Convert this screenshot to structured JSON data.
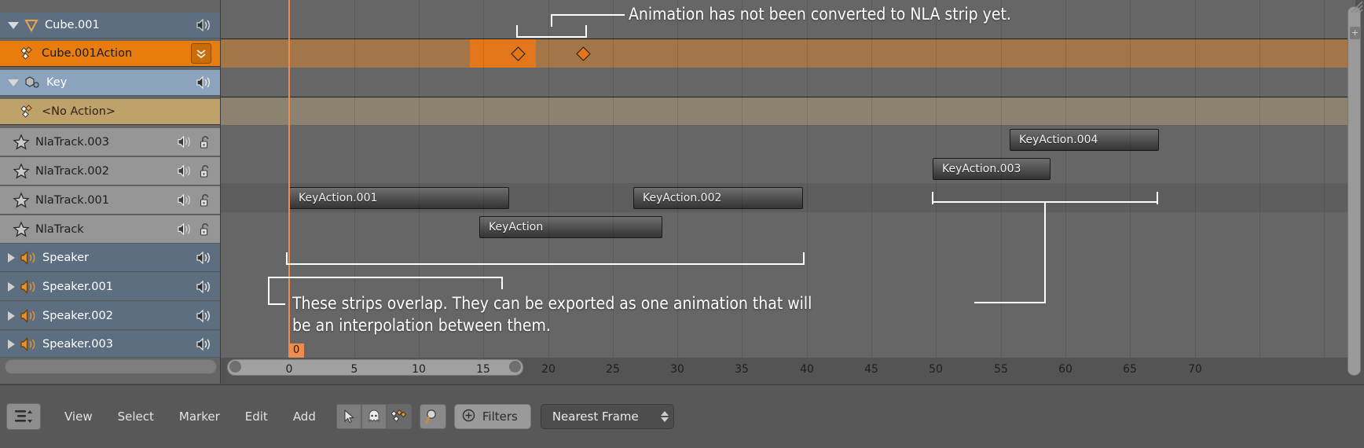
{
  "channels": [
    {
      "name": "Cube.001",
      "type": "object",
      "icon": "mesh-triangle-icon",
      "expander": "down",
      "mute": "speaker-icon",
      "indent": 0
    },
    {
      "name": "Cube.001Action",
      "type": "action",
      "icon": "action-keys-icon",
      "expander": "none",
      "right": "expand-double-icon",
      "indent": 1
    },
    {
      "name": "Key",
      "type": "key",
      "icon": "shapekey-icon",
      "expander": "down",
      "mute": "speaker-icon",
      "indent": 0
    },
    {
      "name": "<No Action>",
      "type": "noaction",
      "icon": "action-keys-icon",
      "expander": "none",
      "indent": 1
    },
    {
      "name": "NlaTrack.003",
      "type": "nlatrack",
      "icon": "star-icon",
      "mute": "speaker-icon",
      "lock": "unlock-icon",
      "indent": 1
    },
    {
      "name": "NlaTrack.002",
      "type": "nlatrack",
      "icon": "star-icon",
      "mute": "speaker-icon",
      "lock": "unlock-icon",
      "indent": 1
    },
    {
      "name": "NlaTrack.001",
      "type": "nlatrack",
      "icon": "star-icon",
      "mute": "speaker-icon",
      "lock": "unlock-icon",
      "indent": 1
    },
    {
      "name": "NlaTrack",
      "type": "nlatrack",
      "icon": "star-icon",
      "mute": "speaker-icon",
      "lock": "unlock-icon",
      "indent": 1
    },
    {
      "name": "Speaker",
      "type": "speaker",
      "icon": "speaker-icon",
      "expander": "right",
      "mute": "speaker-icon",
      "indent": 0
    },
    {
      "name": "Speaker.001",
      "type": "speaker",
      "icon": "speaker-icon",
      "expander": "right",
      "mute": "speaker-icon",
      "indent": 0
    },
    {
      "name": "Speaker.002",
      "type": "speaker",
      "icon": "speaker-icon",
      "expander": "right",
      "mute": "speaker-icon",
      "indent": 0
    },
    {
      "name": "Speaker.003",
      "type": "speaker",
      "icon": "speaker-icon",
      "expander": "right",
      "mute": "speaker-icon",
      "indent": 0
    }
  ],
  "strips": [
    {
      "label": "KeyAction.004",
      "track": "NlaTrack.003"
    },
    {
      "label": "KeyAction.003",
      "track": "NlaTrack.002"
    },
    {
      "label": "KeyAction.001",
      "track": "NlaTrack.001"
    },
    {
      "label": "KeyAction.002",
      "track": "NlaTrack.001"
    },
    {
      "label": "KeyAction",
      "track": "NlaTrack"
    }
  ],
  "annotations": {
    "top": "Animation has not been converted to NLA strip yet.",
    "bottom_line1": "These strips overlap. They can be exported as one animation that will",
    "bottom_line2": "be an interpolation between them."
  },
  "playhead": {
    "value": "0"
  },
  "ruler": {
    "ticks": [
      "0",
      "5",
      "10",
      "15",
      "20",
      "25",
      "30",
      "35",
      "40",
      "45",
      "50",
      "55",
      "60",
      "65",
      "70"
    ]
  },
  "toolbar": {
    "editor_type": "editor-type-icon",
    "menus": [
      "View",
      "Select",
      "Marker",
      "Edit",
      "Add"
    ],
    "tools": [
      "cursor-select-icon",
      "ghost-icon",
      "keyframe-sync-icon"
    ],
    "zoom": "magnifier-icon",
    "filters_label": "Filters",
    "filters_icon": "plus-circle-icon",
    "snap_value": "Nearest Frame"
  },
  "colors": {
    "accent": "#e87d0d",
    "action_track": "#a3764a",
    "noaction_track": "#8c8270",
    "object_row": "#5c6e80",
    "key_row": "#8ba3bc",
    "noaction_row": "#bea26a",
    "nla_row": "#969696",
    "playhead": "#ee8b4f"
  }
}
